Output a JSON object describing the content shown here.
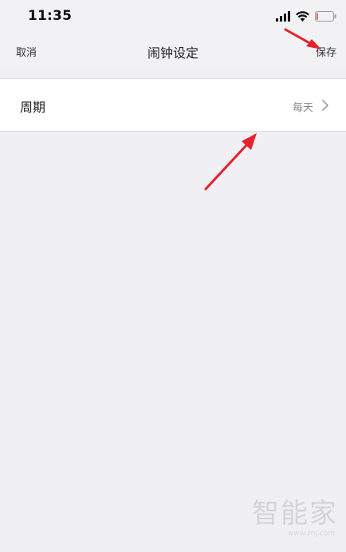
{
  "status_bar": {
    "time": "11:35",
    "icons": [
      "signal-icon",
      "wifi-icon",
      "battery-icon"
    ],
    "battery_level": 0.08,
    "battery_color": "#e53935"
  },
  "nav": {
    "cancel_label": "取消",
    "title": "闹钟设定",
    "save_label": "保存"
  },
  "settings": {
    "period_label": "周期",
    "period_value": "每天"
  },
  "annotation": {
    "arrow_color": "#e8202a"
  },
  "watermark": {
    "logo_text": "智能家",
    "url": "www.znj.com"
  }
}
